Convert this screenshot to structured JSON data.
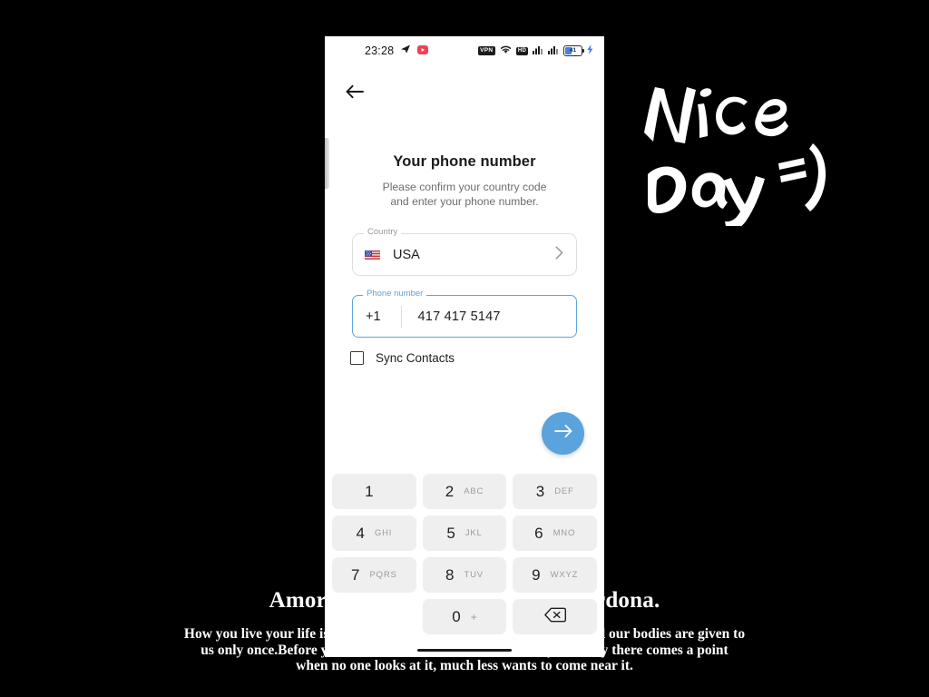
{
  "background": {
    "color": "#000000",
    "caption_title": "Amor con amor se paga, amar perdona.",
    "caption_body_lines": [
      "How you live your life is your business. Just remember, our hearts and our bodies are given to",
      "us only once.Before you know it,  he  becomes  withered;  as your body  there comes a point",
      "when no one looks at it,   much less wants to come near it."
    ],
    "handwriting": {
      "line1": "Nice",
      "line2": "Day",
      "emoticon": "=)",
      "color": "#ffffff"
    }
  },
  "phone": {
    "statusbar": {
      "time": "23:28",
      "left_icons": [
        "telegram-icon",
        "youtube-icon"
      ],
      "vpn_label": "VPN",
      "hd_label": "HD",
      "right_icons": [
        "vpn-badge-icon",
        "wifi-icon",
        "hd-badge-icon",
        "signal-sim1-icon",
        "signal-sim2-icon",
        "battery-icon",
        "charging-bolt-icon"
      ],
      "battery_level": "41"
    },
    "back_button": "back-arrow-icon",
    "title": "Your phone number",
    "subtitle_line1": "Please confirm your country code",
    "subtitle_line2": "and enter your phone number.",
    "country_field": {
      "label": "Country",
      "value": "USA",
      "flag": "us-flag-icon",
      "chevron": "chevron-right-icon"
    },
    "phone_field": {
      "label": "Phone number",
      "country_code": "+1",
      "value": "417 417 5147",
      "accent_color": "#5ea5dd"
    },
    "sync_contacts": {
      "label": "Sync Contacts",
      "checked": false
    },
    "next_button": {
      "icon": "arrow-right-icon",
      "color": "#5ba3dc"
    },
    "keypad": {
      "keys": [
        {
          "num": "1",
          "sub": ""
        },
        {
          "num": "2",
          "sub": "ABC"
        },
        {
          "num": "3",
          "sub": "DEF"
        },
        {
          "num": "4",
          "sub": "GHI"
        },
        {
          "num": "5",
          "sub": "JKL"
        },
        {
          "num": "6",
          "sub": "MNO"
        },
        {
          "num": "7",
          "sub": "PQRS"
        },
        {
          "num": "8",
          "sub": "TUV"
        },
        {
          "num": "9",
          "sub": "WXYZ"
        },
        {
          "num": "0",
          "sub": "+"
        }
      ],
      "backspace": "backspace-icon"
    }
  }
}
